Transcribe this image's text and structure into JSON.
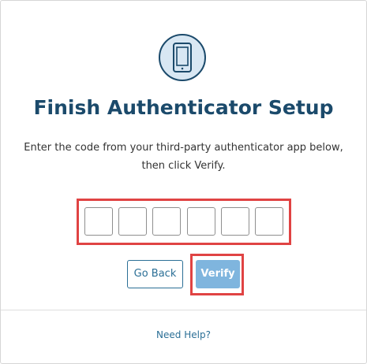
{
  "header": {
    "icon": "mobile-phone-icon",
    "title": "Finish Authenticator Setup",
    "description": "Enter the code from your third-party authenticator app below, then click Verify."
  },
  "code_inputs": {
    "digit_count": 6,
    "values": [
      "",
      "",
      "",
      "",
      "",
      ""
    ]
  },
  "actions": {
    "back_label": "Go Back",
    "verify_label": "Verify"
  },
  "footer": {
    "help_label": "Need Help?"
  },
  "colors": {
    "title": "#1b4a6b",
    "accent": "#2b6f96",
    "verify_bg": "#7fb5de",
    "icon_bg": "#d8e7f3",
    "highlight": "#e04343"
  }
}
